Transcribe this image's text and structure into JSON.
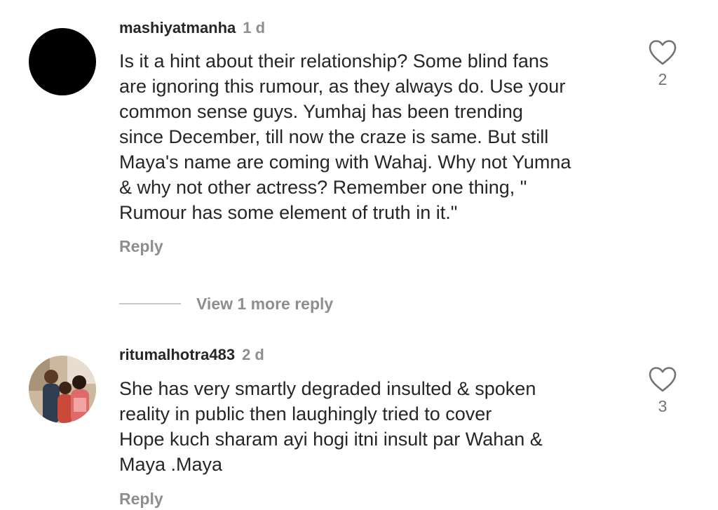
{
  "comments": [
    {
      "username": "mashiyatmanha",
      "time": "1 d",
      "text": "Is it a hint about their relationship? Some blind fans\nare ignoring this rumour, as they always do. Use your\ncommon sense guys. Yumhaj has been trending\nsince December, till now the craze is same. But still\nMaya's name are coming with Wahaj. Why not Yumna\n& why not other actress? Remember one thing, \"\nRumour has some element of truth in it.\"",
      "likes": "2",
      "reply_label": "Reply",
      "avatar": "black-circle"
    },
    {
      "username": "ritumalhotra483",
      "time": "2 d",
      "text": "She has very smartly degraded insulted & spoken\nreality in public then laughingly tried to cover\nHope kuch sharam ayi hogi itni insult par Wahan &\nMaya .Maya",
      "likes": "3",
      "reply_label": "Reply",
      "avatar": "group-photo"
    }
  ],
  "view_more_replies": "View 1 more reply",
  "icons": {
    "like": "heart-outline-icon"
  },
  "colors": {
    "text": "#262626",
    "muted": "#8e8e8e",
    "divider": "#c7c7c7"
  }
}
